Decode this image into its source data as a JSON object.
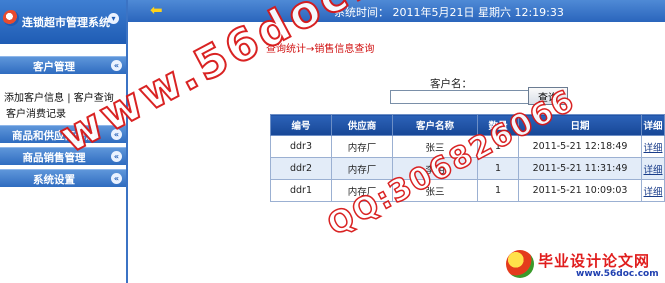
{
  "sidebar": {
    "title": "连锁超市管理系统",
    "sections": [
      {
        "label": "客户管理",
        "links": [
          "添加客户信息",
          "客户查询",
          "客户消费记录"
        ]
      },
      {
        "label": "商品和供应商信息"
      },
      {
        "label": "商品销售管理"
      },
      {
        "label": "系统设置"
      }
    ]
  },
  "topbar": {
    "time_text": "系统时间：  2011年5月21日  星期六   12:19:33"
  },
  "main": {
    "breadcrumb": "查询统计→销售信息查询",
    "search": {
      "label": "客户名：",
      "value": "",
      "button": "查询"
    },
    "table": {
      "headers": [
        "编号",
        "供应商",
        "客户名称",
        "数量",
        "日期",
        "详细"
      ],
      "rows": [
        [
          "ddr3",
          "内存厂",
          "张三",
          "1",
          "2011-5-21 12:18:49",
          "详细"
        ],
        [
          "ddr2",
          "内存厂",
          "李明",
          "1",
          "2011-5-21 11:31:49",
          "详细"
        ],
        [
          "ddr1",
          "内存厂",
          "张三",
          "1",
          "2011-5-21 10:09:03",
          "详细"
        ]
      ]
    }
  },
  "watermark": {
    "line1": "www.56doc.com",
    "line2": "QQ:306826066"
  },
  "brand": {
    "name": "毕业设计论文网",
    "url": "www.56doc.com"
  }
}
